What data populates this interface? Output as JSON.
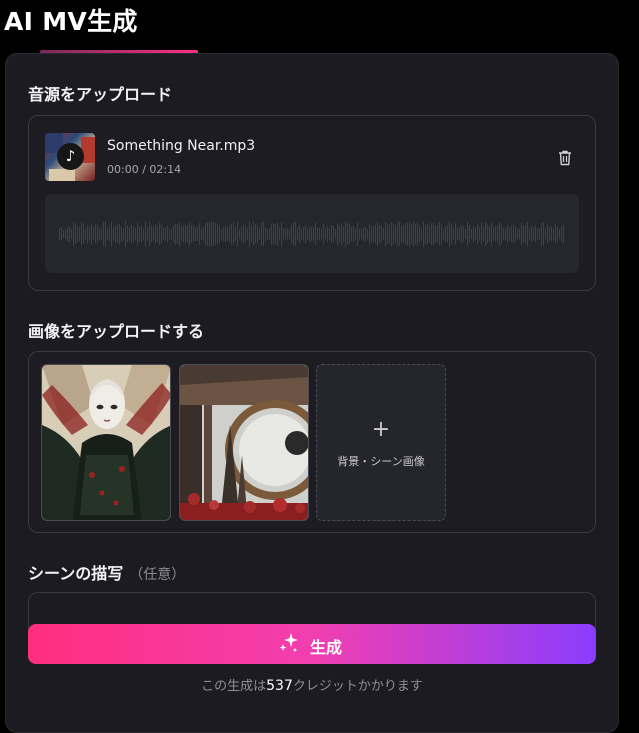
{
  "header": {
    "title": "AI MV生成"
  },
  "audio_section": {
    "title": "音源をアップロード",
    "file_name": "Something Near.mp3",
    "time_display": "00:00 / 02:14",
    "icons": {
      "thumbnail": "music-note-icon",
      "delete": "trash-icon"
    },
    "waveform_color": "#6b2a4f"
  },
  "image_section": {
    "title": "画像をアップロードする",
    "add_tile_label": "背景・シーン画像",
    "add_tile_icon": "+"
  },
  "scene_section": {
    "title": "シーンの描写",
    "optional_label": "（任意）"
  },
  "generate": {
    "button_label": "生成",
    "icon": "sparkle-icon",
    "credit_prefix": "この生成は",
    "credit_count": "537",
    "credit_suffix": "クレジットかかります",
    "gradient": [
      "#ff2e7e",
      "#f23fb0",
      "#8a3dff"
    ]
  }
}
